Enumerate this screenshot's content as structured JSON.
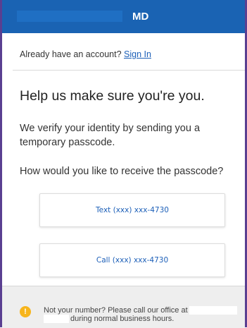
{
  "header": {
    "title": "MD"
  },
  "account": {
    "prompt": "Already have an account?",
    "sign_in_label": "Sign In"
  },
  "main": {
    "heading": "Help us make sure you're you.",
    "explanation": "We verify your identity by sending you a temporary passcode.",
    "question": "How would you like to receive the passcode?",
    "options": [
      {
        "label": "Text (xxx) xxx-4730"
      },
      {
        "label": "Call (xxx) xxx-4730"
      }
    ]
  },
  "notice": {
    "icon": "info-icon",
    "text_before": "Not your number? Please call our office at",
    "text_after": "during normal business hours."
  },
  "colors": {
    "header_bg": "#1a63b3",
    "link": "#1c5fb8",
    "frame_border": "#5a3f91",
    "notice_bg": "#eeeeee",
    "icon_bg": "#f7b51c"
  }
}
